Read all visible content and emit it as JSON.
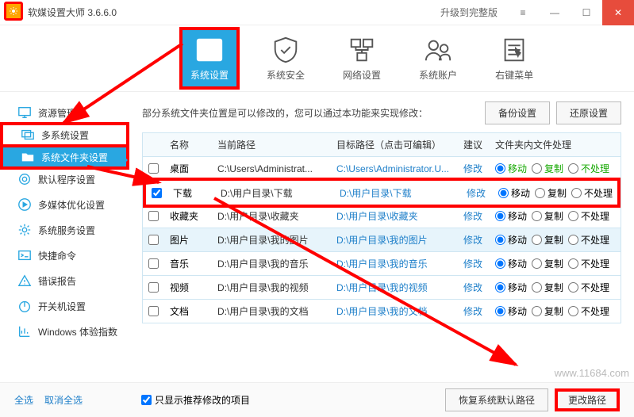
{
  "window": {
    "title": "软媒设置大师 3.6.6.0",
    "upgrade": "升级到完整版"
  },
  "toolbar": [
    {
      "key": "sys",
      "label": "系统设置"
    },
    {
      "key": "sec",
      "label": "系统安全"
    },
    {
      "key": "net",
      "label": "网络设置"
    },
    {
      "key": "acct",
      "label": "系统账户"
    },
    {
      "key": "ctx",
      "label": "右键菜单"
    }
  ],
  "sidebar": [
    {
      "key": "explorer",
      "label": "资源管理器"
    },
    {
      "key": "multi",
      "label": "多系统设置"
    },
    {
      "key": "folders",
      "label": "系统文件夹设置"
    },
    {
      "key": "default",
      "label": "默认程序设置"
    },
    {
      "key": "media",
      "label": "多媒体优化设置"
    },
    {
      "key": "service",
      "label": "系统服务设置"
    },
    {
      "key": "quick",
      "label": "快捷命令"
    },
    {
      "key": "error",
      "label": "错误报告"
    },
    {
      "key": "boot",
      "label": "开关机设置"
    },
    {
      "key": "wei",
      "label": "Windows 体验指数"
    }
  ],
  "description": "部分系统文件夹位置是可以修改的，您可以通过本功能来实现修改：",
  "buttons": {
    "backup": "备份设置",
    "restore": "还原设置",
    "reset": "恢复系统默认路径",
    "change": "更改路径"
  },
  "columns": {
    "name": "名称",
    "current": "当前路径",
    "target": "目标路径（点击可编辑）",
    "suggest": "建议",
    "ops": "文件夹内文件处理"
  },
  "ops": {
    "move": "移动",
    "copy": "复制",
    "none": "不处理"
  },
  "rows": [
    {
      "chk": false,
      "name": "桌面",
      "cur": "C:\\Users\\Administrat...",
      "tgt": "C:\\Users\\Administrator.U...",
      "sug": "修改",
      "op": "move",
      "green": true
    },
    {
      "chk": true,
      "name": "下载",
      "cur": "D:\\用户目录\\下载",
      "tgt": "D:\\用户目录\\下载",
      "sug": "修改",
      "op": "move"
    },
    {
      "chk": false,
      "name": "收藏夹",
      "cur": "D:\\用户目录\\收藏夹",
      "tgt": "D:\\用户目录\\收藏夹",
      "sug": "修改",
      "op": "move"
    },
    {
      "chk": false,
      "name": "图片",
      "cur": "D:\\用户目录\\我的图片",
      "tgt": "D:\\用户目录\\我的图片",
      "sug": "修改",
      "op": "move"
    },
    {
      "chk": false,
      "name": "音乐",
      "cur": "D:\\用户目录\\我的音乐",
      "tgt": "D:\\用户目录\\我的音乐",
      "sug": "修改",
      "op": "move"
    },
    {
      "chk": false,
      "name": "视频",
      "cur": "D:\\用户目录\\我的视频",
      "tgt": "D:\\用户目录\\我的视频",
      "sug": "修改",
      "op": "move"
    },
    {
      "chk": false,
      "name": "文档",
      "cur": "D:\\用户目录\\我的文档",
      "tgt": "D:\\用户目录\\我的文档",
      "sug": "修改",
      "op": "move"
    }
  ],
  "footer": {
    "selectAll": "全选",
    "deselectAll": "取消全选",
    "onlyRec": "只显示推荐修改的项目"
  },
  "watermark": "www.11684.com"
}
